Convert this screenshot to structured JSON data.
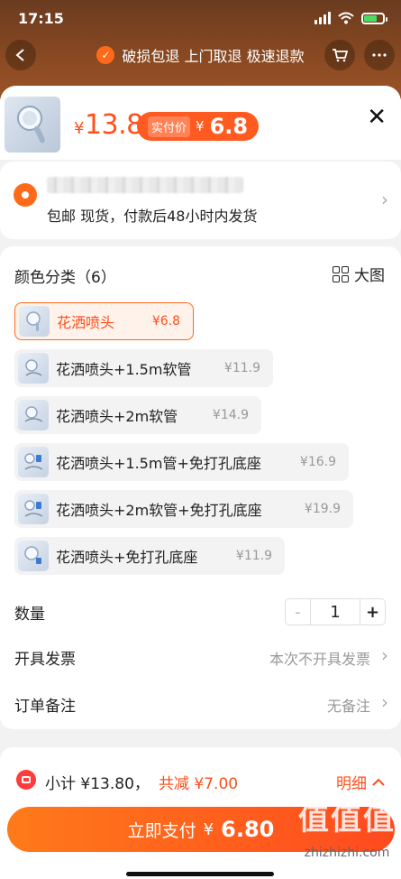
{
  "status_bar": {
    "time": "17:15"
  },
  "banner": {
    "text": "破损包退 上门取退 极速退款"
  },
  "header": {
    "price_currency": "¥",
    "price": "13.8",
    "real_label": "实付价",
    "real_currency": "¥",
    "real_price": "6.8"
  },
  "address": {
    "shipping_line": "包邮  现货，付款后48小时内发货"
  },
  "specs": {
    "title": "颜色分类（6）",
    "big_pic": "大图",
    "options": [
      {
        "name": "花洒喷头",
        "price": "¥6.8",
        "selected": true
      },
      {
        "name": "花洒喷头+1.5m软管",
        "price": "¥11.9",
        "selected": false
      },
      {
        "name": "花洒喷头+2m软管",
        "price": "¥14.9",
        "selected": false
      },
      {
        "name": "花洒喷头+1.5m管+免打孔底座",
        "price": "¥16.9",
        "selected": false
      },
      {
        "name": "花洒喷头+2m软管+免打孔底座",
        "price": "¥19.9",
        "selected": false
      },
      {
        "name": "花洒喷头+免打孔底座",
        "price": "¥11.9",
        "selected": false
      }
    ],
    "quantity_label": "数量",
    "quantity_minus": "-",
    "quantity_value": "1",
    "quantity_plus": "+",
    "invoice_label": "开具发票",
    "invoice_value": "本次不开具发票",
    "note_label": "订单备注",
    "note_value": "无备注"
  },
  "footer": {
    "subtotal": "小计 ¥13.80，",
    "discount": "共减 ¥7.00",
    "detail": "明细",
    "pay_label": "立即支付",
    "pay_currency": "¥",
    "pay_amount": "6.80"
  },
  "watermark": {
    "glyphs": "值值值",
    "url": "zhizhizhi.com"
  },
  "colors": {
    "accent": "#ff5a1f",
    "accent_light": "#fff2ea",
    "price_orange": "#ff4f1a"
  }
}
